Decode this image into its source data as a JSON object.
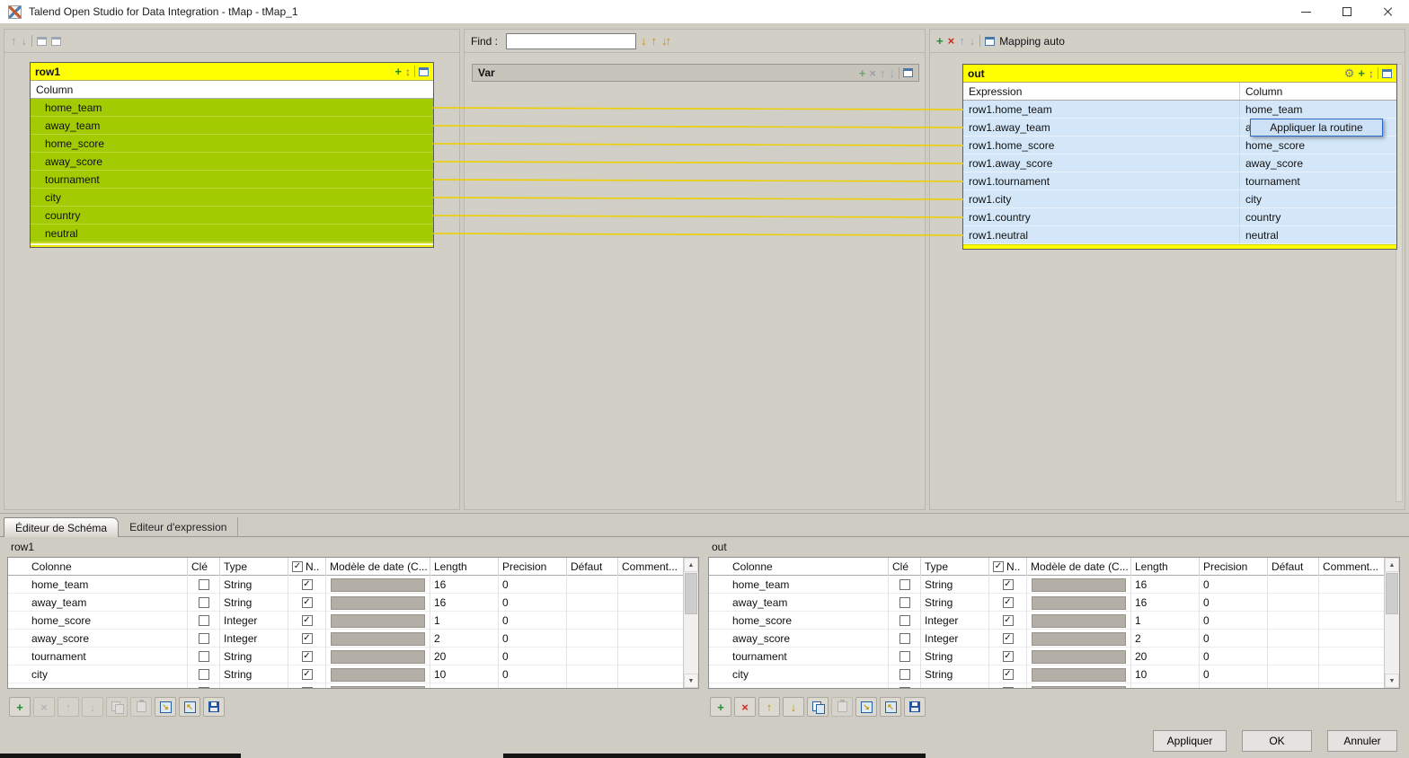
{
  "titlebar": {
    "title": "Talend Open Studio for Data Integration - tMap - tMap_1"
  },
  "icons": {
    "plus": "+",
    "remove": "×",
    "up": "↑",
    "down": "↓",
    "sort": "↕",
    "gear": "⚙",
    "check": "✓",
    "find_next": "↓",
    "find_prev": "↑",
    "highlight": "↓↑",
    "scroll_up": "▲",
    "scroll_down": "▼"
  },
  "top": {
    "find_label": "Find :",
    "find_value": "",
    "mapping_auto": "Mapping auto",
    "input_table": {
      "name": "row1",
      "column_header": "Column",
      "rows": [
        "home_team",
        "away_team",
        "home_score",
        "away_score",
        "tournament",
        "city",
        "country",
        "neutral"
      ]
    },
    "var_table": {
      "name": "Var"
    },
    "out_table": {
      "name": "out",
      "expression_header": "Expression",
      "column_header": "Column",
      "rows": [
        {
          "expression": "row1.home_team",
          "column": "home_team"
        },
        {
          "expression": "row1.away_team",
          "column": "away_team"
        },
        {
          "expression": "row1.home_score",
          "column": "home_score"
        },
        {
          "expression": "row1.away_score",
          "column": "away_score"
        },
        {
          "expression": "row1.tournament",
          "column": "tournament"
        },
        {
          "expression": "row1.city",
          "column": "city"
        },
        {
          "expression": "row1.country",
          "column": "country"
        },
        {
          "expression": "row1.neutral",
          "column": "neutral"
        }
      ]
    },
    "tooltip": "Appliquer la routine"
  },
  "bottom": {
    "tabs": [
      "Éditeur de Schéma",
      "Editeur d'expression"
    ],
    "schema_headers": [
      "Colonne",
      "Clé",
      "Type",
      "N..",
      "Modèle de date (C...",
      "Length",
      "Precision",
      "Défaut",
      "Comment..."
    ],
    "schemas": [
      {
        "title": "row1",
        "rows": [
          {
            "name": "home_team",
            "key": false,
            "type": "String",
            "nullable": true,
            "length": "16",
            "precision": "0",
            "default": "",
            "comment": ""
          },
          {
            "name": "away_team",
            "key": false,
            "type": "String",
            "nullable": true,
            "length": "16",
            "precision": "0",
            "default": "",
            "comment": ""
          },
          {
            "name": "home_score",
            "key": false,
            "type": "Integer",
            "nullable": true,
            "length": "1",
            "precision": "0",
            "default": "",
            "comment": ""
          },
          {
            "name": "away_score",
            "key": false,
            "type": "Integer",
            "nullable": true,
            "length": "2",
            "precision": "0",
            "default": "",
            "comment": ""
          },
          {
            "name": "tournament",
            "key": false,
            "type": "String",
            "nullable": true,
            "length": "20",
            "precision": "0",
            "default": "",
            "comment": ""
          },
          {
            "name": "city",
            "key": false,
            "type": "String",
            "nullable": true,
            "length": "10",
            "precision": "0",
            "default": "",
            "comment": ""
          },
          {
            "name": "",
            "key": false,
            "type": "",
            "nullable": true,
            "length": "",
            "precision": "",
            "default": "",
            "comment": ""
          }
        ]
      },
      {
        "title": "out",
        "rows": [
          {
            "name": "home_team",
            "key": false,
            "type": "String",
            "nullable": true,
            "length": "16",
            "precision": "0",
            "default": "",
            "comment": ""
          },
          {
            "name": "away_team",
            "key": false,
            "type": "String",
            "nullable": true,
            "length": "16",
            "precision": "0",
            "default": "",
            "comment": ""
          },
          {
            "name": "home_score",
            "key": false,
            "type": "Integer",
            "nullable": true,
            "length": "1",
            "precision": "0",
            "default": "",
            "comment": ""
          },
          {
            "name": "away_score",
            "key": false,
            "type": "Integer",
            "nullable": true,
            "length": "2",
            "precision": "0",
            "default": "",
            "comment": ""
          },
          {
            "name": "tournament",
            "key": false,
            "type": "String",
            "nullable": true,
            "length": "20",
            "precision": "0",
            "default": "",
            "comment": ""
          },
          {
            "name": "city",
            "key": false,
            "type": "String",
            "nullable": true,
            "length": "10",
            "precision": "0",
            "default": "",
            "comment": ""
          },
          {
            "name": "",
            "key": false,
            "type": "",
            "nullable": true,
            "length": "",
            "precision": "",
            "default": "",
            "comment": ""
          }
        ]
      }
    ],
    "buttons": [
      "Appliquer",
      "OK",
      "Annuler"
    ]
  },
  "colors": {
    "header_yellow": "#ffff00",
    "row_green": "#a2cb01",
    "row_blue": "#d3e7f8",
    "mapping_line": "#eecf00",
    "tooltip_bg": "#cde1f6",
    "tooltip_border": "#2a66c9"
  }
}
